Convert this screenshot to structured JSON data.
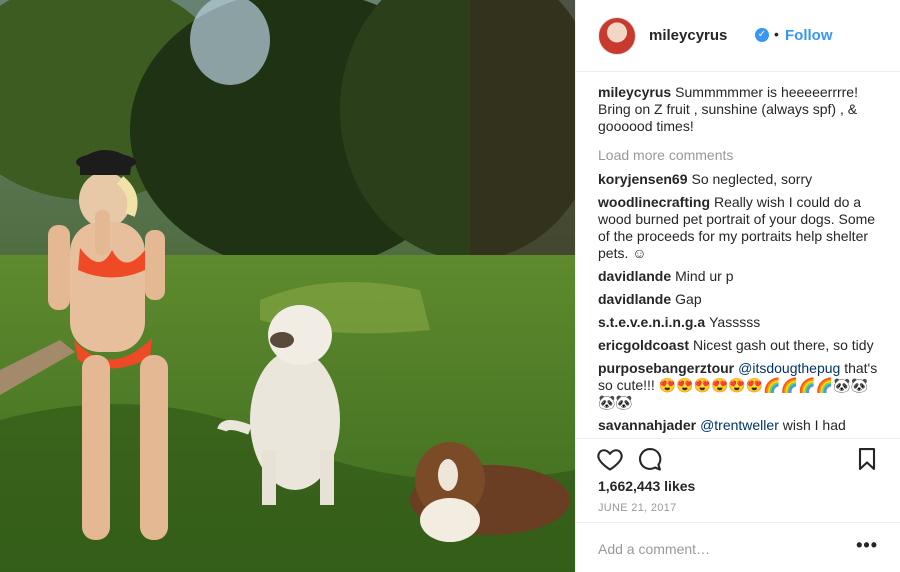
{
  "header": {
    "username": "mileycyrus",
    "verified_icon": "verified-badge-icon",
    "separator": "•",
    "follow_label": "Follow",
    "accent_color": "#3897f0"
  },
  "caption": {
    "username": "mileycyrus",
    "text": "Summmmmer is heeeeerrrre! Bring on Z fruit , sunshine (always spf) , & goooood times!"
  },
  "load_more_label": "Load more comments",
  "comments": [
    {
      "username": "koryjensen69",
      "text": "So neglected, sorry"
    },
    {
      "username": "woodlinecrafting",
      "text": "Really wish I could do a wood burned pet portrait of your dogs. Some of the proceeds for my portraits help shelter pets. ☺"
    },
    {
      "username": "davidlande",
      "text": "Mind ur p"
    },
    {
      "username": "davidlande",
      "text": "Gap"
    },
    {
      "username": "s.t.e.v.e.n.i.n.g.a",
      "text": "Yasssss"
    },
    {
      "username": "ericgoldcoast",
      "text": "Nicest gash out there, so tidy"
    },
    {
      "username": "purposebangerztour",
      "mention": "@itsdougthepug",
      "text": "that's so cute!!! 😍😍😍😍😍😍🌈🌈🌈🌈🐼🐼🐼🐼"
    },
    {
      "username": "savannahjader",
      "mention": "@trentweller",
      "text": "wish I had"
    }
  ],
  "actions": {
    "like_icon": "heart-icon",
    "comment_icon": "comment-bubble-icon",
    "save_icon": "bookmark-icon"
  },
  "likes_label": "1,662,443 likes",
  "date_label": "JUNE 21, 2017",
  "add_comment": {
    "placeholder": "Add a comment…",
    "more_label": "•••"
  }
}
